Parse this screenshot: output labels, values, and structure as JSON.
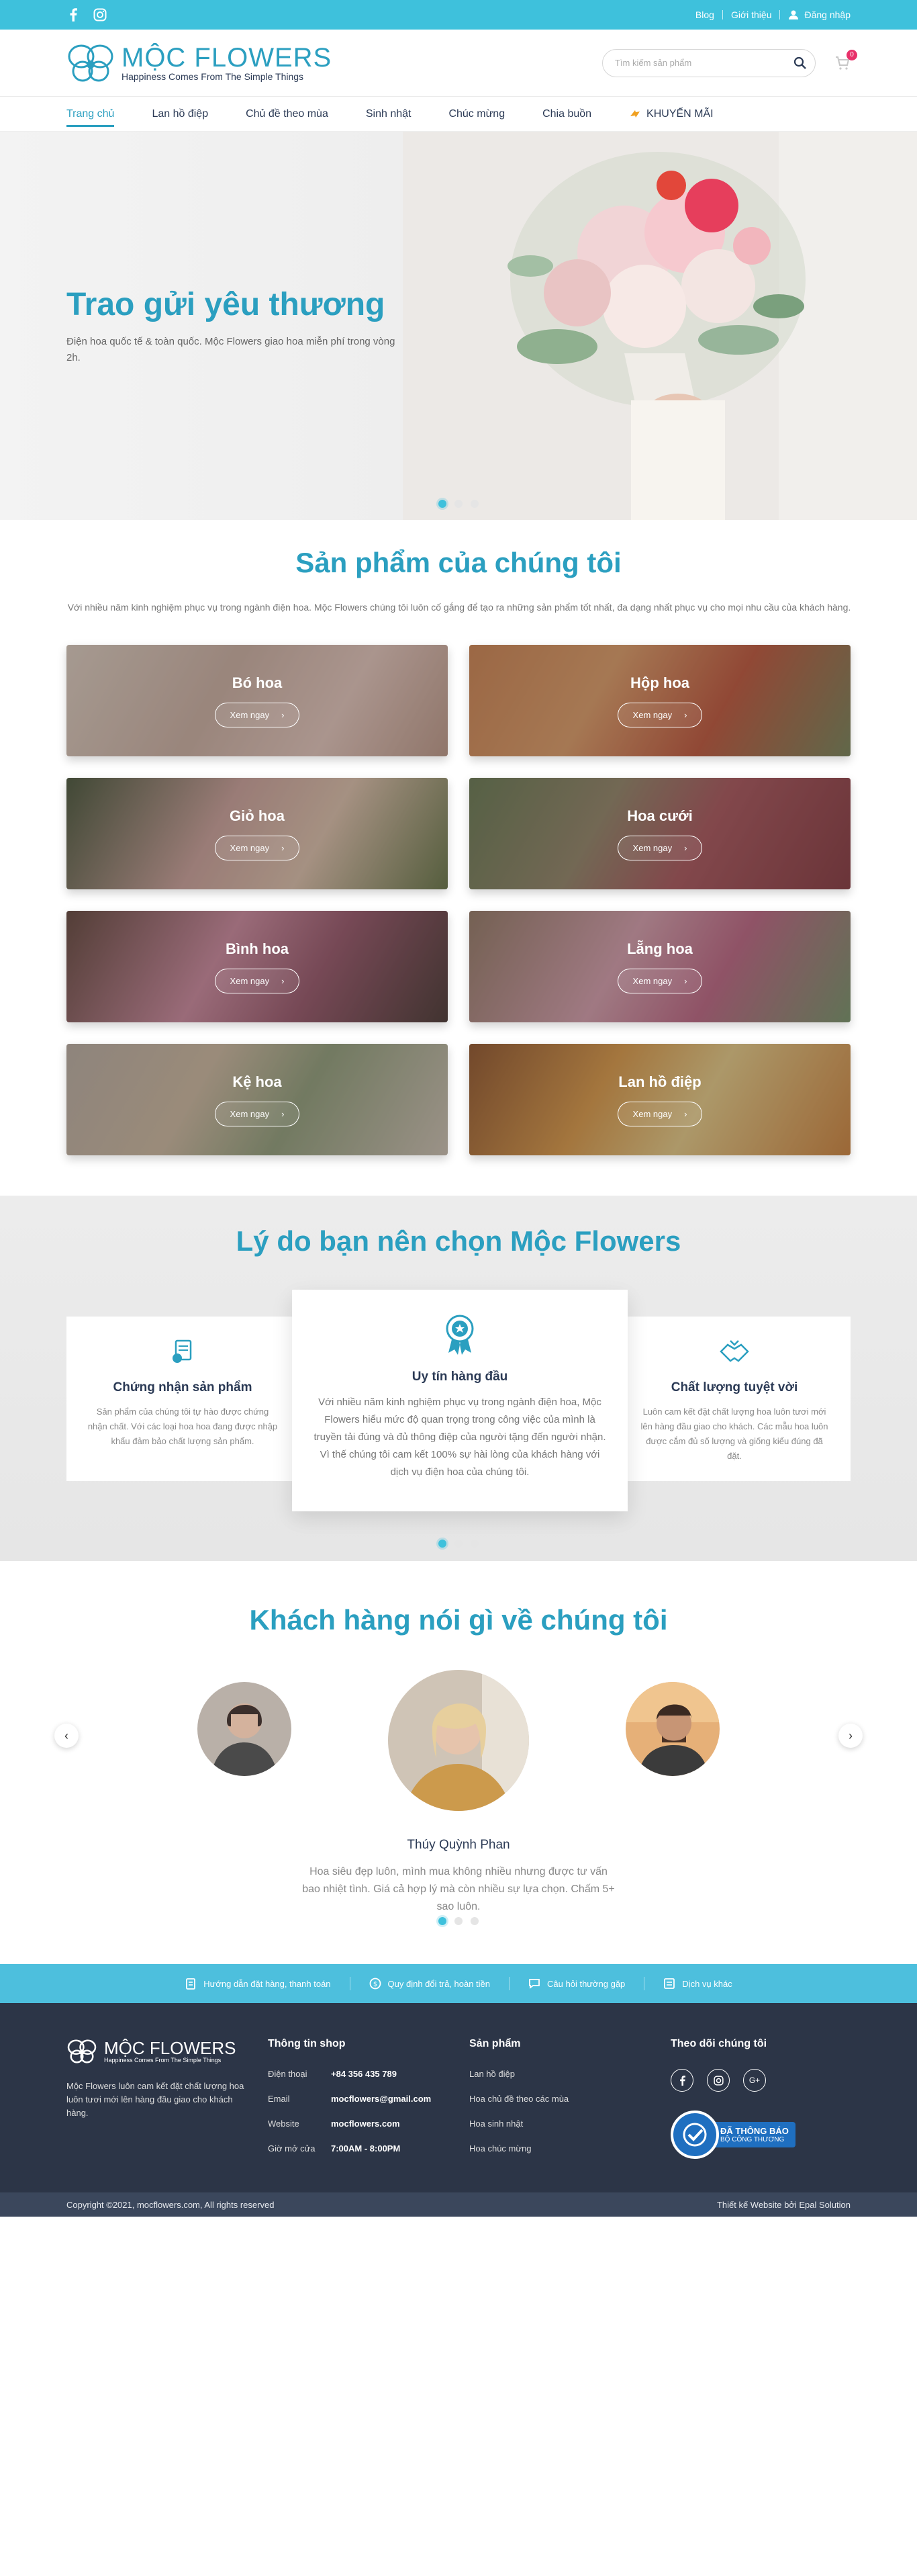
{
  "topbar": {
    "blog": "Blog",
    "about": "Giới thiệu",
    "login": "Đăng nhập"
  },
  "header": {
    "logo_name": "MỘC FLOWERS",
    "logo_tagline": "Happiness Comes From The Simple Things",
    "search_placeholder": "Tìm kiếm sản phẩm",
    "cart_count": "0"
  },
  "nav": {
    "items": [
      {
        "label": "Trang chủ"
      },
      {
        "label": "Lan hồ điệp"
      },
      {
        "label": "Chủ đề theo mùa"
      },
      {
        "label": "Sinh nhật"
      },
      {
        "label": "Chúc mừng"
      },
      {
        "label": "Chia buồn"
      },
      {
        "label": "KHUYẾN MÃI"
      }
    ]
  },
  "hero": {
    "title": "Trao gửi yêu thương",
    "subtitle": "Điện hoa quốc tế & toàn quốc. Mộc Flowers giao hoa miễn phí trong vòng 2h."
  },
  "products": {
    "title": "Sản phẩm của chúng tôi",
    "desc": "Với nhiều năm kinh nghiệm phục vụ trong ngành điện hoa. Mộc Flowers chúng tôi luôn cố gắng để tạo ra những sản phẩm tốt nhất, đa dạng nhất phục vụ cho mọi nhu cầu của khách hàng.",
    "button_label": "Xem ngay",
    "items": [
      {
        "name": "Bó hoa"
      },
      {
        "name": "Hộp hoa"
      },
      {
        "name": "Giỏ hoa"
      },
      {
        "name": "Hoa cưới"
      },
      {
        "name": "Bình hoa"
      },
      {
        "name": "Lẵng hoa"
      },
      {
        "name": "Kệ hoa"
      },
      {
        "name": "Lan hồ điệp"
      }
    ]
  },
  "why": {
    "title": "Lý do bạn nên chọn Mộc Flowers",
    "cards": [
      {
        "title": "Chứng nhận sản phẩm",
        "text": "Sản phẩm của chúng tôi tự hào được chứng nhận chất. Với các loại hoa hoa đang được nhập khẩu đảm bảo chất lượng sản phẩm."
      },
      {
        "title": "Uy tín hàng đầu",
        "text": "Với nhiều năm kinh nghiệm phục vụ trong ngành điện hoa, Mộc Flowers hiểu mức độ quan trọng trong công việc của mình là truyền tải đúng và đủ thông điệp của người tặng đến người nhận. Vì thế chúng tôi cam kết 100% sự hài lòng của khách hàng với dịch vụ điện hoa của chúng tôi."
      },
      {
        "title": "Chất lượng tuyệt vời",
        "text": "Luôn cam kết đặt chất lượng hoa luôn tươi mới lên hàng đầu giao cho khách. Các mẫu hoa luôn được cắm đủ số lượng và giống kiểu đúng đã đặt."
      }
    ]
  },
  "testimonials": {
    "title": "Khách hàng nói gì về chúng tôi",
    "name": "Thúy Quỳnh Phan",
    "quote": "Hoa siêu đẹp luôn, mình mua không nhiều nhưng được tư vấn bao nhiệt tình. Giá cả hợp lý mà còn nhiều sự lựa chọn. Chấm 5+ sao luôn."
  },
  "strip": {
    "items": [
      {
        "label": "Hướng dẫn đặt hàng, thanh toán"
      },
      {
        "label": "Quy định đổi trả, hoàn tiền"
      },
      {
        "label": "Câu hỏi thường gặp"
      },
      {
        "label": "Dịch vụ khác"
      }
    ]
  },
  "footer": {
    "about": "Mộc Flowers luôn cam kết đặt chất lượng hoa luôn tươi mới lên hàng đầu giao cho khách hàng.",
    "shop_title": "Thông tin shop",
    "shop_rows": [
      {
        "k": "Điện thoại",
        "v": "+84 356 435 789"
      },
      {
        "k": "Email",
        "v": "mocflowers@gmail.com"
      },
      {
        "k": "Website",
        "v": "mocflowers.com"
      },
      {
        "k": "Giờ mở cửa",
        "v": "7:00AM - 8:00PM"
      }
    ],
    "product_title": "Sản phẩm",
    "product_links": [
      "Lan hồ điệp",
      "Hoa chủ đề theo các mùa",
      "Hoa sinh nhật",
      "Hoa chúc mừng"
    ],
    "follow_title": "Theo dõi chúng tôi",
    "bct_line1": "ĐÃ THÔNG BÁO",
    "bct_line2": "BỘ CÔNG THƯƠNG",
    "copyright": "Copyright ©2021, mocflowers.com, All rights reserved",
    "design": "Thiết kế Website bởi Epal Solution"
  }
}
